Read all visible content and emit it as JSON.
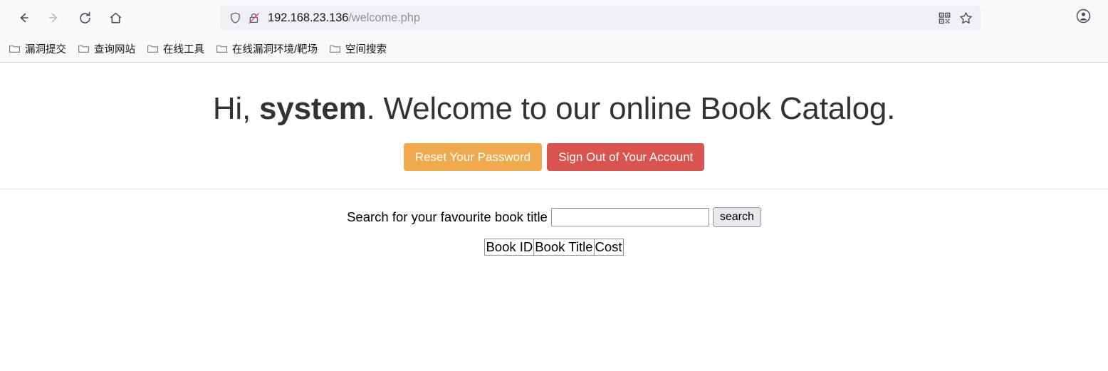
{
  "browser": {
    "nav": {
      "back_label": "Back",
      "forward_label": "Forward",
      "reload_label": "Reload",
      "home_label": "Home"
    },
    "url_bar": {
      "host": "192.168.23.136",
      "path": "/welcome.php",
      "shield_label": "Enhanced Tracking Protection",
      "lock_label": "Connection is not secure",
      "qr_label": "QR code",
      "bookmark_label": "Bookmark this page"
    },
    "account_label": "Account",
    "bookmarks": [
      {
        "label": "漏洞提交",
        "icon": "folder-icon"
      },
      {
        "label": "查询网站",
        "icon": "folder-icon"
      },
      {
        "label": "在线工具",
        "icon": "folder-icon"
      },
      {
        "label": "在线漏洞环境/靶场",
        "icon": "folder-icon"
      },
      {
        "label": "空间搜索",
        "icon": "folder-icon"
      }
    ]
  },
  "page": {
    "headline_prefix": "Hi, ",
    "headline_user": "system",
    "headline_suffix": ". Welcome to our online Book Catalog.",
    "buttons": {
      "reset_password": "Reset Your Password",
      "sign_out": "Sign Out of Your Account"
    },
    "search": {
      "label": "Search for your favourite book title",
      "input_value": "",
      "input_placeholder": "",
      "button_label": "search"
    },
    "table": {
      "headers": [
        "Book ID",
        "Book Title",
        "Cost"
      ],
      "rows": []
    }
  },
  "colors": {
    "warning": "#eeaa4d",
    "danger": "#d9534f",
    "chrome_bg": "#f9f9fb",
    "urlbar_bg": "#f0f0f4",
    "text": "#15141a",
    "heading": "#333333"
  }
}
